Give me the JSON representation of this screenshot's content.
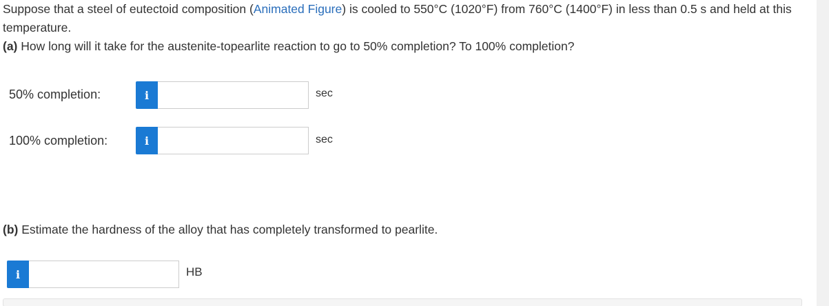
{
  "question": {
    "intro_before_link": "Suppose that a steel of eutectoid composition (",
    "link_text": "Animated Figure",
    "intro_after_link": ") is cooled to 550°C (1020°F) from 760°C (1400°F) in less than 0.5 s and held at this temperature.",
    "part_a_label": "(a)",
    "part_a_text": " How long will it take for the austenite-topearlite reaction to go to 50% completion? To 100% completion?",
    "part_b_label": "(b)",
    "part_b_text": " Estimate the hardness of the alloy that has completely transformed to pearlite."
  },
  "answers": {
    "row1": {
      "label": "50% completion:",
      "info_icon": "i",
      "value": "",
      "unit": "sec"
    },
    "row2": {
      "label": "100% completion:",
      "info_icon": "i",
      "value": "",
      "unit": "sec"
    },
    "row3": {
      "info_icon": "i",
      "value": "",
      "unit": "HB"
    }
  },
  "colors": {
    "link": "#2a6ebb",
    "info_button": "#1a7ad4",
    "text": "#333333"
  }
}
